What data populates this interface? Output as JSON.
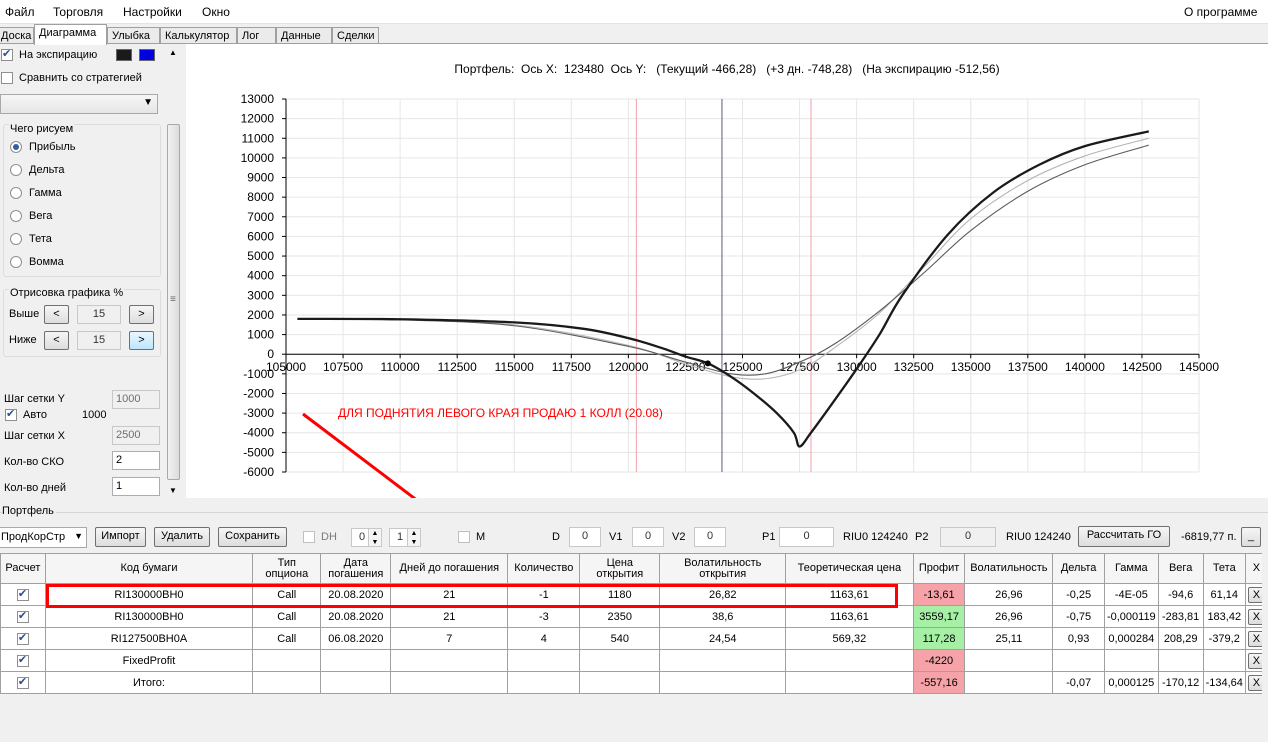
{
  "menu": {
    "items": [
      "Файл",
      "Торговля",
      "Настройки",
      "Окно"
    ],
    "about": "О программе"
  },
  "tabs": [
    "Доска",
    "Диаграмма",
    "Улыбка",
    "Калькулятор",
    "Лог",
    "Данные",
    "Сделки"
  ],
  "active_tab": "Диаграмма",
  "left": {
    "expiry_checkbox": "На экспирацию",
    "expiry_checked": true,
    "compare_checkbox": "Сравнить со стратегией",
    "compare_checked": false,
    "strategy_select": "",
    "draw_group": "Чего рисуем",
    "draw_options": [
      "Прибыль",
      "Дельта",
      "Гамма",
      "Вега",
      "Тета",
      "Вомма"
    ],
    "draw_selected": "Прибыль",
    "render_group": "Отрисовка графика %",
    "above_label": "Выше",
    "above_value": "15",
    "below_label": "Ниже",
    "below_value": "15",
    "dec": "<",
    "inc": ">",
    "grid_y_label": "Шаг сетки Y",
    "grid_y_value": "1000",
    "auto_label": "Авто",
    "auto_checked": true,
    "auto_value": "1000",
    "grid_x_label": "Шаг сетки X",
    "grid_x_value": "2500",
    "sko_label": "Кол-во СКО",
    "sko_value": "2",
    "days_label": "Кол-во дней",
    "days_value": "1",
    "colors": {
      "swatch_black": "#1a1a1a",
      "swatch_blue": "#0000e0"
    }
  },
  "chart_data": {
    "type": "line",
    "title": "Портфель:  Ось X:  123480  Ось Y:   (Текущий -466,28)   (+3 дн. -748,28)   (На экспирацию -512,56)",
    "xlabel": "",
    "ylabel": "",
    "xlim": [
      105000,
      145000
    ],
    "ylim": [
      -6000,
      13000
    ],
    "x_ticks": [
      105000,
      107500,
      110000,
      112500,
      115000,
      117500,
      120000,
      122500,
      125000,
      127500,
      130000,
      132500,
      135000,
      137500,
      140000,
      142500,
      145000
    ],
    "y_ticks": [
      -6000,
      -5000,
      -4000,
      -3000,
      -2000,
      -1000,
      0,
      1000,
      2000,
      3000,
      4000,
      5000,
      6000,
      7000,
      8000,
      9000,
      10000,
      11000,
      12000,
      13000
    ],
    "grid": true,
    "vertical_lines": [
      {
        "x": 120350,
        "color": "#f3a0a8"
      },
      {
        "x": 124100,
        "color": "#5c5c80"
      },
      {
        "x": 128000,
        "color": "#f3a0a8"
      }
    ],
    "marker": {
      "x": 123480,
      "y": -466
    },
    "series": [
      {
        "color": "#1a1a1a",
        "width": 2.3,
        "x": [
          105500,
          110000,
          115000,
          118000,
          120000,
          121500,
          122500,
          123480,
          124500,
          125500,
          126500,
          127250,
          127500,
          128000,
          129000,
          130000,
          131000,
          132000,
          134000,
          136000,
          138000,
          140000,
          142800
        ],
        "y": [
          1800,
          1780,
          1620,
          1300,
          820,
          300,
          -120,
          -466,
          -1150,
          -2000,
          -3000,
          -4000,
          -4700,
          -4000,
          -2400,
          -750,
          1000,
          3000,
          6100,
          8250,
          9650,
          10600,
          11350
        ]
      },
      {
        "color": "#5a5a5a",
        "width": 1.1,
        "x": [
          105500,
          110000,
          115000,
          120000,
          122500,
          124500,
          126000,
          127500,
          129000,
          131000,
          133000,
          135000,
          137500,
          140000,
          142800
        ],
        "y": [
          1800,
          1750,
          1450,
          400,
          -400,
          -1000,
          -1000,
          -400,
          500,
          2200,
          4200,
          6300,
          8300,
          9650,
          10650
        ]
      },
      {
        "color": "#b5b5b5",
        "width": 1.1,
        "x": [
          105500,
          110000,
          115000,
          120000,
          122500,
          124500,
          126000,
          127500,
          129000,
          131000,
          133000,
          135000,
          137500,
          140000,
          142800
        ],
        "y": [
          1800,
          1760,
          1500,
          450,
          -500,
          -1150,
          -1250,
          -800,
          300,
          2100,
          4500,
          6900,
          8850,
          10100,
          11000
        ]
      }
    ],
    "annotation": {
      "text": "ДЛЯ ПОДНЯТИЯ ЛЕВОГО КРАЯ ПРОДАЮ 1 КОЛЛ (20.08)",
      "color": "#ff0000"
    }
  },
  "portfolio": {
    "group_label": "Портфель",
    "strategy_value": "ПродКорСтр",
    "import_button": "Импорт",
    "delete_button": "Удалить",
    "save_button": "Сохранить",
    "dh_label": "DH",
    "spin1": "0",
    "spin2": "1",
    "m_label": "M",
    "d_label": "D",
    "d_value": "0",
    "v1_label": "V1",
    "v1_value": "0",
    "v2_label": "V2",
    "v2_value": "0",
    "p1_label": "P1",
    "p1_value": "0",
    "riu1": "RIU0 124240",
    "p2_label": "P2",
    "p2_value": "0",
    "riu2": "RIU0 124240",
    "calc_go_button": "Рассчитать ГО",
    "go_value": "-6819,77 п.",
    "min_button": "_",
    "headers": [
      "Расчет",
      "Код бумаги",
      "Тип опциона",
      "Дата погашения",
      "Дней до погашения",
      "Количество",
      "Цена открытия",
      "Волатильность открытия",
      "Теоретическая цена",
      "Профит",
      "Волатильность",
      "Дельта",
      "Гамма",
      "Вега",
      "Тета",
      "X"
    ],
    "rows": [
      [
        "RI130000BH0",
        "Call",
        "20.08.2020",
        "21",
        "-1",
        "1180",
        "26,82",
        "1163,61",
        "-13,61",
        "26,96",
        "-0,25",
        "-4E-05",
        "-94,6",
        "61,14"
      ],
      [
        "RI130000BH0",
        "Call",
        "20.08.2020",
        "21",
        "-3",
        "2350",
        "38,6",
        "1163,61",
        "3559,17",
        "26,96",
        "-0,75",
        "-0,000119",
        "-283,81",
        "183,42"
      ],
      [
        "RI127500BH0A",
        "Call",
        "06.08.2020",
        "7",
        "4",
        "540",
        "24,54",
        "569,32",
        "117,28",
        "25,11",
        "0,93",
        "0,000284",
        "208,29",
        "-379,2"
      ],
      [
        "FixedProfit",
        "",
        "",
        "",
        "",
        "",
        "",
        "",
        "-4220",
        "",
        "",
        "",
        "",
        ""
      ],
      [
        "Итого:",
        "",
        "",
        "",
        "",
        "",
        "",
        "",
        "-557,16",
        "",
        "-0,07",
        "0,000125",
        "-170,12",
        "-134,64"
      ]
    ],
    "profit_status": [
      "neg",
      "pos",
      "pos",
      "neg",
      "neg"
    ],
    "x_label": "X",
    "colors": {
      "negative": "#f5a3a8",
      "positive": "#a6f0a6",
      "highlight": "#ff0000"
    }
  }
}
